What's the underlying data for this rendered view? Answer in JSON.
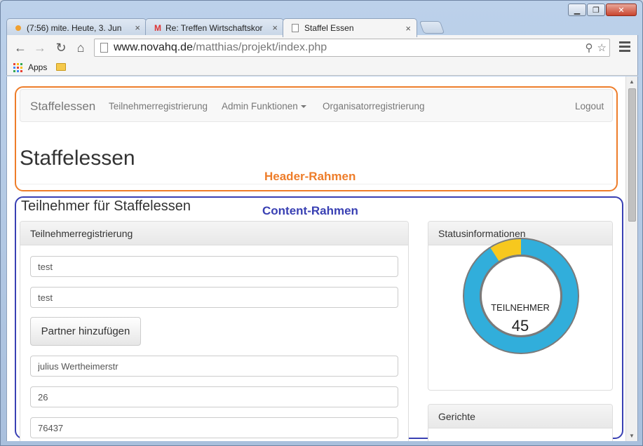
{
  "browser": {
    "tabs": [
      {
        "title": "(7:56) mite. Heute, 3. Jun",
        "close": "×"
      },
      {
        "title": "Re: Treffen Wirtschaftskor",
        "close": "×"
      },
      {
        "title": "Staffel Essen",
        "close": "×"
      }
    ],
    "url_host": "www.novahq.de",
    "url_path": "/matthias/projekt/index.php",
    "bookmarks": {
      "apps_label": "Apps"
    }
  },
  "navbar": {
    "brand": "Staffelessen",
    "items": [
      "Teilnehmerregistrierung",
      "Admin Funktionen",
      "Organisatorregistrierung"
    ],
    "logout": "Logout"
  },
  "page": {
    "header": "Staffelessen",
    "section_title": "Teilnehmer für Staffelessen"
  },
  "annotations": {
    "header_frame": "Header-Rahmen",
    "content_frame": "Content-Rahmen",
    "header_color": "#ee7d2a",
    "content_color": "#3940b3"
  },
  "registration": {
    "heading": "Teilnehmerregistrierung",
    "fields": [
      "test",
      "test",
      "julius Wertheimerstr",
      "26",
      "76437"
    ],
    "partner_button": "Partner hinzufügen"
  },
  "status": {
    "heading": "Statusinformationen",
    "donut_label": "TEILNEHMER",
    "donut_value": "45",
    "donut_colors": {
      "main": "#31aedb",
      "accent": "#f7c81e",
      "ring": "#7a7a7a"
    },
    "accent_fraction": 0.09
  },
  "gerichte": {
    "heading": "Gerichte"
  }
}
